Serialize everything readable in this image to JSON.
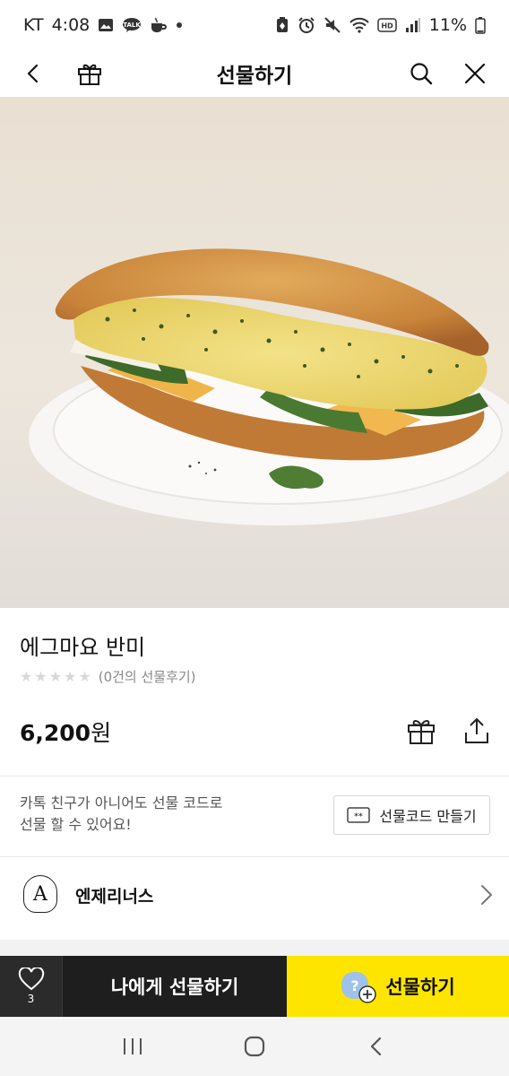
{
  "status_bar": {
    "carrier": "KT",
    "time": "4:08",
    "battery": "11%",
    "icons": [
      "gallery-icon",
      "talk-icon",
      "coffee-icon",
      "dot-icon",
      "battery-saver-icon",
      "alarm-icon",
      "mute-icon",
      "wifi-icon",
      "hd-icon",
      "signal-icon"
    ]
  },
  "header": {
    "title": "선물하기",
    "icons": [
      "back-icon",
      "gift-icon",
      "search-icon",
      "close-icon"
    ]
  },
  "product": {
    "name": "에그마요 반미",
    "rating_stars": 0,
    "review_text": "(0건의 선물후기)",
    "price": "6,200",
    "price_unit": "원"
  },
  "gift_code": {
    "info_line1": "카톡 친구가 아니어도 선물 코드로",
    "info_line2": "선물 할 수 있어요!",
    "button_label": "선물코드 만들기"
  },
  "brand": {
    "name": "엔제리너스",
    "logo_letter": "A"
  },
  "action_bar": {
    "like_count": "3",
    "gift_self_label": "나에게 선물하기",
    "gift_label": "선물하기",
    "accent_color": "#fee500"
  },
  "nav_bar": {
    "icons": [
      "recent-apps-icon",
      "home-icon",
      "back-nav-icon"
    ]
  }
}
